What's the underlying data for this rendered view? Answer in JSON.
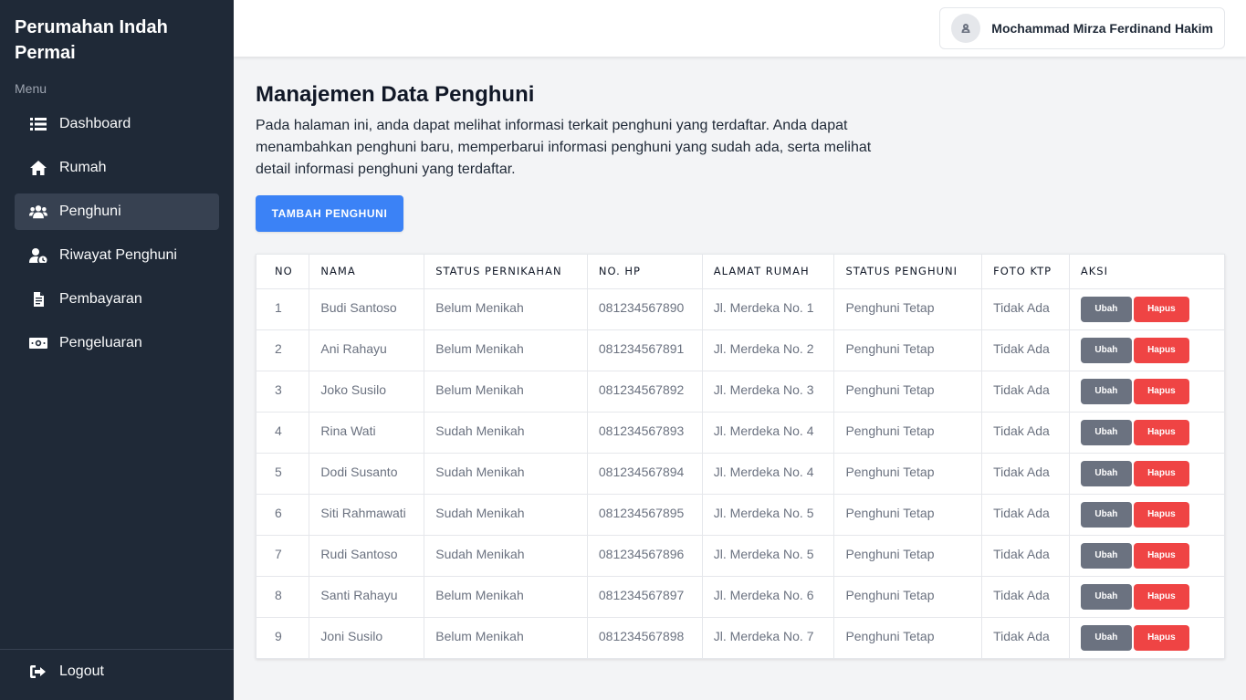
{
  "sidebar": {
    "brand": "Perumahan Indah Permai",
    "menu_label": "Menu",
    "items": [
      {
        "label": "Dashboard",
        "icon": "list-icon"
      },
      {
        "label": "Rumah",
        "icon": "home-icon"
      },
      {
        "label": "Penghuni",
        "icon": "users-icon",
        "active": true
      },
      {
        "label": "Riwayat Penghuni",
        "icon": "user-clock-icon"
      },
      {
        "label": "Pembayaran",
        "icon": "file-invoice-icon"
      },
      {
        "label": "Pengeluaran",
        "icon": "money-bill-icon"
      }
    ],
    "logout_label": "Logout"
  },
  "header": {
    "user_name": "Mochammad Mirza Ferdinand Hakim"
  },
  "main": {
    "title": "Manajemen Data Penghuni",
    "description": "Pada halaman ini, anda dapat melihat informasi terkait penghuni yang terdaftar. Anda dapat menambahkan penghuni baru, memperbarui informasi penghuni yang sudah ada, serta melihat detail informasi penghuni yang terdaftar.",
    "add_button": "TAMBAH PENGHUNI",
    "table": {
      "headers": [
        "NO",
        "NAMA",
        "STATUS PERNIKAHAN",
        "NO. HP",
        "ALAMAT RUMAH",
        "STATUS PENGHUNI",
        "FOTO KTP",
        "AKSI"
      ],
      "rows": [
        {
          "no": "1",
          "nama": "Budi Santoso",
          "status_pernikahan": "Belum Menikah",
          "no_hp": "081234567890",
          "alamat": "Jl. Merdeka No. 1",
          "status_penghuni": "Penghuni Tetap",
          "foto_ktp": "Tidak Ada"
        },
        {
          "no": "2",
          "nama": "Ani Rahayu",
          "status_pernikahan": "Belum Menikah",
          "no_hp": "081234567891",
          "alamat": "Jl. Merdeka No. 2",
          "status_penghuni": "Penghuni Tetap",
          "foto_ktp": "Tidak Ada"
        },
        {
          "no": "3",
          "nama": "Joko Susilo",
          "status_pernikahan": "Belum Menikah",
          "no_hp": "081234567892",
          "alamat": "Jl. Merdeka No. 3",
          "status_penghuni": "Penghuni Tetap",
          "foto_ktp": "Tidak Ada"
        },
        {
          "no": "4",
          "nama": "Rina Wati",
          "status_pernikahan": "Sudah Menikah",
          "no_hp": "081234567893",
          "alamat": "Jl. Merdeka No. 4",
          "status_penghuni": "Penghuni Tetap",
          "foto_ktp": "Tidak Ada"
        },
        {
          "no": "5",
          "nama": "Dodi Susanto",
          "status_pernikahan": "Sudah Menikah",
          "no_hp": "081234567894",
          "alamat": "Jl. Merdeka No. 4",
          "status_penghuni": "Penghuni Tetap",
          "foto_ktp": "Tidak Ada"
        },
        {
          "no": "6",
          "nama": "Siti Rahmawati",
          "status_pernikahan": "Sudah Menikah",
          "no_hp": "081234567895",
          "alamat": "Jl. Merdeka No. 5",
          "status_penghuni": "Penghuni Tetap",
          "foto_ktp": "Tidak Ada"
        },
        {
          "no": "7",
          "nama": "Rudi Santoso",
          "status_pernikahan": "Sudah Menikah",
          "no_hp": "081234567896",
          "alamat": "Jl. Merdeka No. 5",
          "status_penghuni": "Penghuni Tetap",
          "foto_ktp": "Tidak Ada"
        },
        {
          "no": "8",
          "nama": "Santi Rahayu",
          "status_pernikahan": "Belum Menikah",
          "no_hp": "081234567897",
          "alamat": "Jl. Merdeka No. 6",
          "status_penghuni": "Penghuni Tetap",
          "foto_ktp": "Tidak Ada"
        },
        {
          "no": "9",
          "nama": "Joni Susilo",
          "status_pernikahan": "Belum Menikah",
          "no_hp": "081234567898",
          "alamat": "Jl. Merdeka No. 7",
          "status_penghuni": "Penghuni Tetap",
          "foto_ktp": "Tidak Ada"
        }
      ],
      "edit_label": "Ubah",
      "delete_label": "Hapus"
    }
  },
  "colors": {
    "sidebar_bg": "#1f2937",
    "sidebar_active": "#374151",
    "primary": "#3b82f6",
    "edit_button": "#6b7280",
    "delete_button": "#ef4444",
    "page_bg": "#f3f4f6"
  }
}
